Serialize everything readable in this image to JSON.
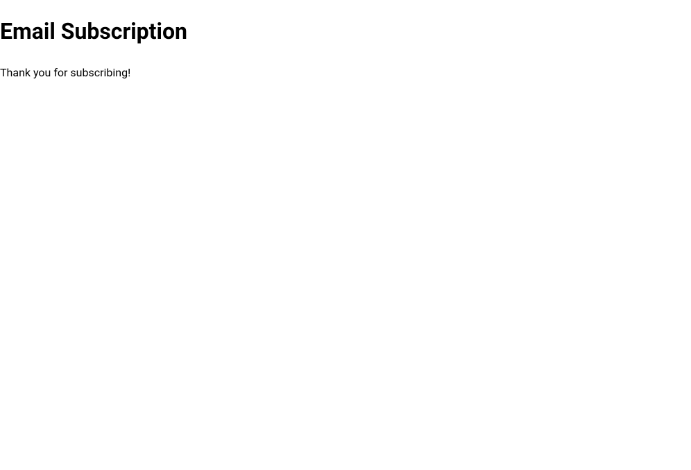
{
  "heading": "Email Subscription",
  "message": "Thank you for subscribing!"
}
